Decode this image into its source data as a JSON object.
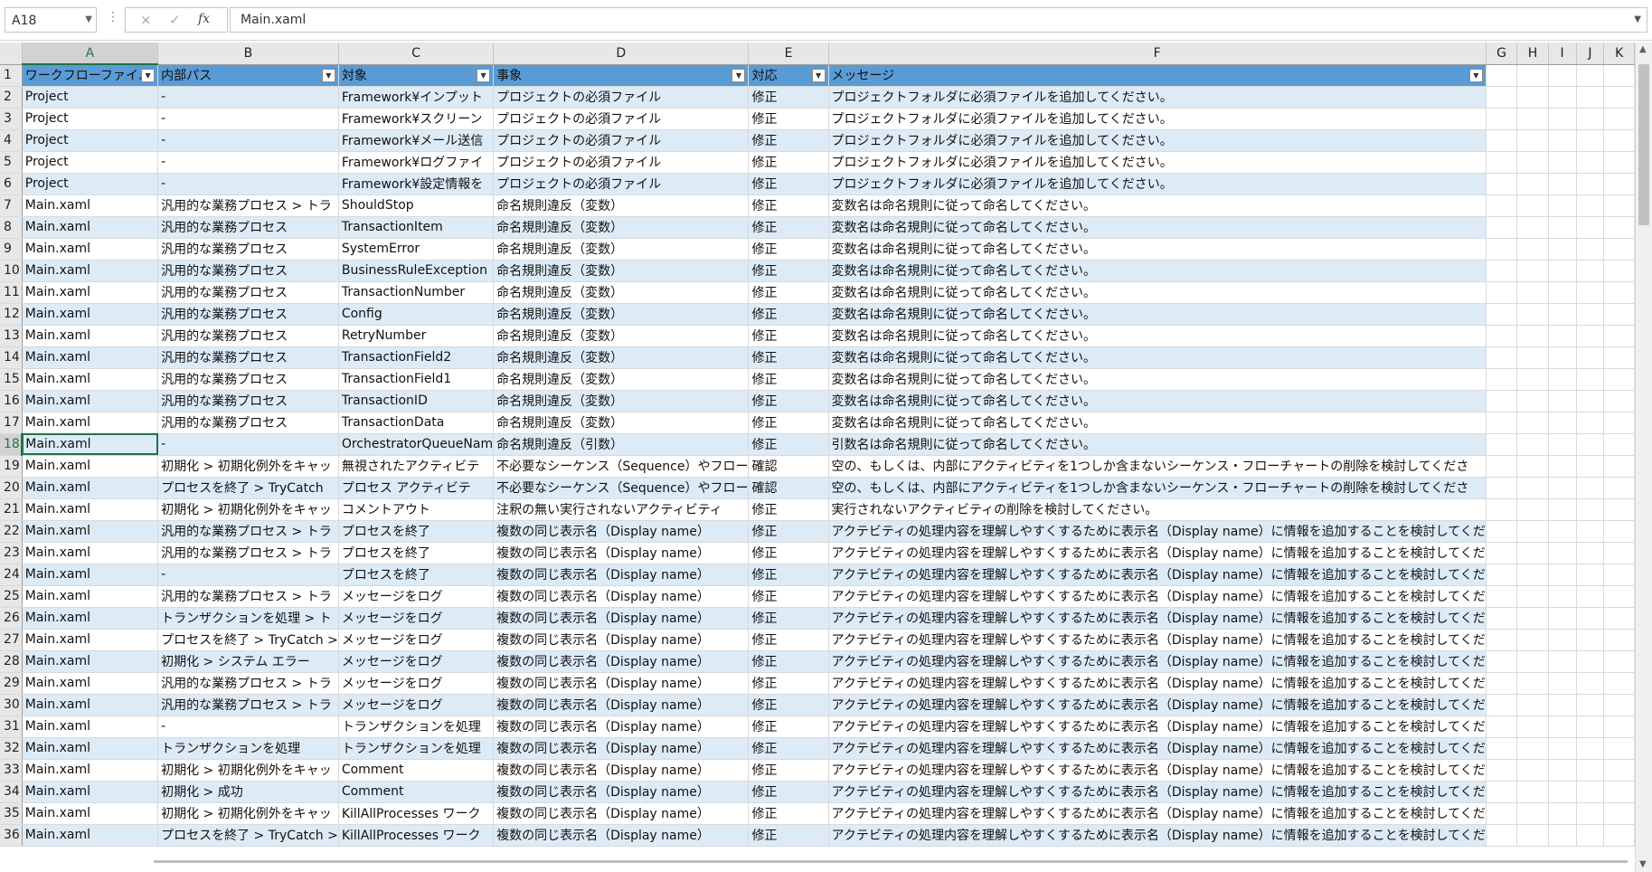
{
  "formula_bar": {
    "name_box": "A18",
    "cancel_icon": "×",
    "enter_icon": "✓",
    "function_icon": "fx",
    "formula_value": "Main.xaml"
  },
  "columns": [
    "A",
    "B",
    "C",
    "D",
    "E",
    "F",
    "G",
    "H",
    "I",
    "J",
    "K"
  ],
  "selected_column": "A",
  "selected_row": 18,
  "table_headers": [
    "ワークフローファイル",
    "内部パス",
    "対象",
    "事象",
    "対応",
    "メッセージ"
  ],
  "rows": [
    [
      "Project",
      "-",
      "Framework¥インプット",
      "プロジェクトの必須ファイル",
      "修正",
      "プロジェクトフォルダに必須ファイルを追加してください。"
    ],
    [
      "Project",
      "-",
      "Framework¥スクリーン",
      "プロジェクトの必須ファイル",
      "修正",
      "プロジェクトフォルダに必須ファイルを追加してください。"
    ],
    [
      "Project",
      "-",
      "Framework¥メール送信",
      "プロジェクトの必須ファイル",
      "修正",
      "プロジェクトフォルダに必須ファイルを追加してください。"
    ],
    [
      "Project",
      "-",
      "Framework¥ログファイ",
      "プロジェクトの必須ファイル",
      "修正",
      "プロジェクトフォルダに必須ファイルを追加してください。"
    ],
    [
      "Project",
      "-",
      "Framework¥設定情報を",
      "プロジェクトの必須ファイル",
      "修正",
      "プロジェクトフォルダに必須ファイルを追加してください。"
    ],
    [
      "Main.xaml",
      "汎用的な業務プロセス > トラ",
      "ShouldStop",
      "命名規則違反（変数）",
      "修正",
      "変数名は命名規則に従って命名してください。"
    ],
    [
      "Main.xaml",
      "汎用的な業務プロセス",
      "TransactionItem",
      "命名規則違反（変数）",
      "修正",
      "変数名は命名規則に従って命名してください。"
    ],
    [
      "Main.xaml",
      "汎用的な業務プロセス",
      "SystemError",
      "命名規則違反（変数）",
      "修正",
      "変数名は命名規則に従って命名してください。"
    ],
    [
      "Main.xaml",
      "汎用的な業務プロセス",
      "BusinessRuleException",
      "命名規則違反（変数）",
      "修正",
      "変数名は命名規則に従って命名してください。"
    ],
    [
      "Main.xaml",
      "汎用的な業務プロセス",
      "TransactionNumber",
      "命名規則違反（変数）",
      "修正",
      "変数名は命名規則に従って命名してください。"
    ],
    [
      "Main.xaml",
      "汎用的な業務プロセス",
      "Config",
      "命名規則違反（変数）",
      "修正",
      "変数名は命名規則に従って命名してください。"
    ],
    [
      "Main.xaml",
      "汎用的な業務プロセス",
      "RetryNumber",
      "命名規則違反（変数）",
      "修正",
      "変数名は命名規則に従って命名してください。"
    ],
    [
      "Main.xaml",
      "汎用的な業務プロセス",
      "TransactionField2",
      "命名規則違反（変数）",
      "修正",
      "変数名は命名規則に従って命名してください。"
    ],
    [
      "Main.xaml",
      "汎用的な業務プロセス",
      "TransactionField1",
      "命名規則違反（変数）",
      "修正",
      "変数名は命名規則に従って命名してください。"
    ],
    [
      "Main.xaml",
      "汎用的な業務プロセス",
      "TransactionID",
      "命名規則違反（変数）",
      "修正",
      "変数名は命名規則に従って命名してください。"
    ],
    [
      "Main.xaml",
      "汎用的な業務プロセス",
      "TransactionData",
      "命名規則違反（変数）",
      "修正",
      "変数名は命名規則に従って命名してください。"
    ],
    [
      "Main.xaml",
      "-",
      "OrchestratorQueueNam",
      "命名規則違反（引数）",
      "修正",
      "引数名は命名規則に従って命名してください。"
    ],
    [
      "Main.xaml",
      "初期化 > 初期化例外をキャッ",
      "無視されたアクティビテ",
      "不必要なシーケンス（Sequence）やフロー",
      "確認",
      "空の、もしくは、内部にアクティビティを1つしか含まないシーケンス・フローチャートの削除を検討してくださ"
    ],
    [
      "Main.xaml",
      "プロセスを終了 > TryCatch",
      "プロセス アクティビテ",
      "不必要なシーケンス（Sequence）やフロー",
      "確認",
      "空の、もしくは、内部にアクティビティを1つしか含まないシーケンス・フローチャートの削除を検討してくださ"
    ],
    [
      "Main.xaml",
      "初期化 > 初期化例外をキャッ",
      "コメントアウト",
      "注釈の無い実行されないアクティビティ",
      "修正",
      "実行されないアクティビティの削除を検討してください。"
    ],
    [
      "Main.xaml",
      "汎用的な業務プロセス > トラ",
      "プロセスを終了",
      "複数の同じ表示名（Display name）",
      "修正",
      "アクテビティの処理内容を理解しやすくするために表示名（Display name）に情報を追加することを検討してくだ"
    ],
    [
      "Main.xaml",
      "汎用的な業務プロセス > トラ",
      "プロセスを終了",
      "複数の同じ表示名（Display name）",
      "修正",
      "アクテビティの処理内容を理解しやすくするために表示名（Display name）に情報を追加することを検討してくだ"
    ],
    [
      "Main.xaml",
      "-",
      "プロセスを終了",
      "複数の同じ表示名（Display name）",
      "修正",
      "アクテビティの処理内容を理解しやすくするために表示名（Display name）に情報を追加することを検討してくだ"
    ],
    [
      "Main.xaml",
      "汎用的な業務プロセス > トラ",
      "メッセージをログ",
      "複数の同じ表示名（Display name）",
      "修正",
      "アクテビティの処理内容を理解しやすくするために表示名（Display name）に情報を追加することを検討してくだ"
    ],
    [
      "Main.xaml",
      "トランザクションを処理 > ト",
      "メッセージをログ",
      "複数の同じ表示名（Display name）",
      "修正",
      "アクテビティの処理内容を理解しやすくするために表示名（Display name）に情報を追加することを検討してくだ"
    ],
    [
      "Main.xaml",
      "プロセスを終了 > TryCatch >",
      "メッセージをログ",
      "複数の同じ表示名（Display name）",
      "修正",
      "アクテビティの処理内容を理解しやすくするために表示名（Display name）に情報を追加することを検討してくだ"
    ],
    [
      "Main.xaml",
      "初期化 > システム エラー",
      "メッセージをログ",
      "複数の同じ表示名（Display name）",
      "修正",
      "アクテビティの処理内容を理解しやすくするために表示名（Display name）に情報を追加することを検討してくだ"
    ],
    [
      "Main.xaml",
      "汎用的な業務プロセス > トラ",
      "メッセージをログ",
      "複数の同じ表示名（Display name）",
      "修正",
      "アクテビティの処理内容を理解しやすくするために表示名（Display name）に情報を追加することを検討してくだ"
    ],
    [
      "Main.xaml",
      "汎用的な業務プロセス > トラ",
      "メッセージをログ",
      "複数の同じ表示名（Display name）",
      "修正",
      "アクテビティの処理内容を理解しやすくするために表示名（Display name）に情報を追加することを検討してくだ"
    ],
    [
      "Main.xaml",
      "-",
      "トランザクションを処理",
      "複数の同じ表示名（Display name）",
      "修正",
      "アクテビティの処理内容を理解しやすくするために表示名（Display name）に情報を追加することを検討してくだ"
    ],
    [
      "Main.xaml",
      "トランザクションを処理",
      "トランザクションを処理",
      "複数の同じ表示名（Display name）",
      "修正",
      "アクテビティの処理内容を理解しやすくするために表示名（Display name）に情報を追加することを検討してくだ"
    ],
    [
      "Main.xaml",
      "初期化 > 初期化例外をキャッ",
      "Comment",
      "複数の同じ表示名（Display name）",
      "修正",
      "アクテビティの処理内容を理解しやすくするために表示名（Display name）に情報を追加することを検討してくだ"
    ],
    [
      "Main.xaml",
      "初期化 > 成功",
      "Comment",
      "複数の同じ表示名（Display name）",
      "修正",
      "アクテビティの処理内容を理解しやすくするために表示名（Display name）に情報を追加することを検討してくだ"
    ],
    [
      "Main.xaml",
      "初期化 > 初期化例外をキャッ",
      "KillAllProcesses ワーク",
      "複数の同じ表示名（Display name）",
      "修正",
      "アクテビティの処理内容を理解しやすくするために表示名（Display name）に情報を追加することを検討してくだ"
    ],
    [
      "Main.xaml",
      "プロセスを終了 > TryCatch >",
      "KillAllProcesses ワーク",
      "複数の同じ表示名（Display name）",
      "修正",
      "アクテビティの処理内容を理解しやすくするために表示名（Display name）に情報を追加することを検討してくだ"
    ]
  ],
  "colors": {
    "header_fill": "#5b9bd5",
    "band_fill": "#ddebf7",
    "selection": "#217346",
    "gridline": "#d9d9d9"
  }
}
